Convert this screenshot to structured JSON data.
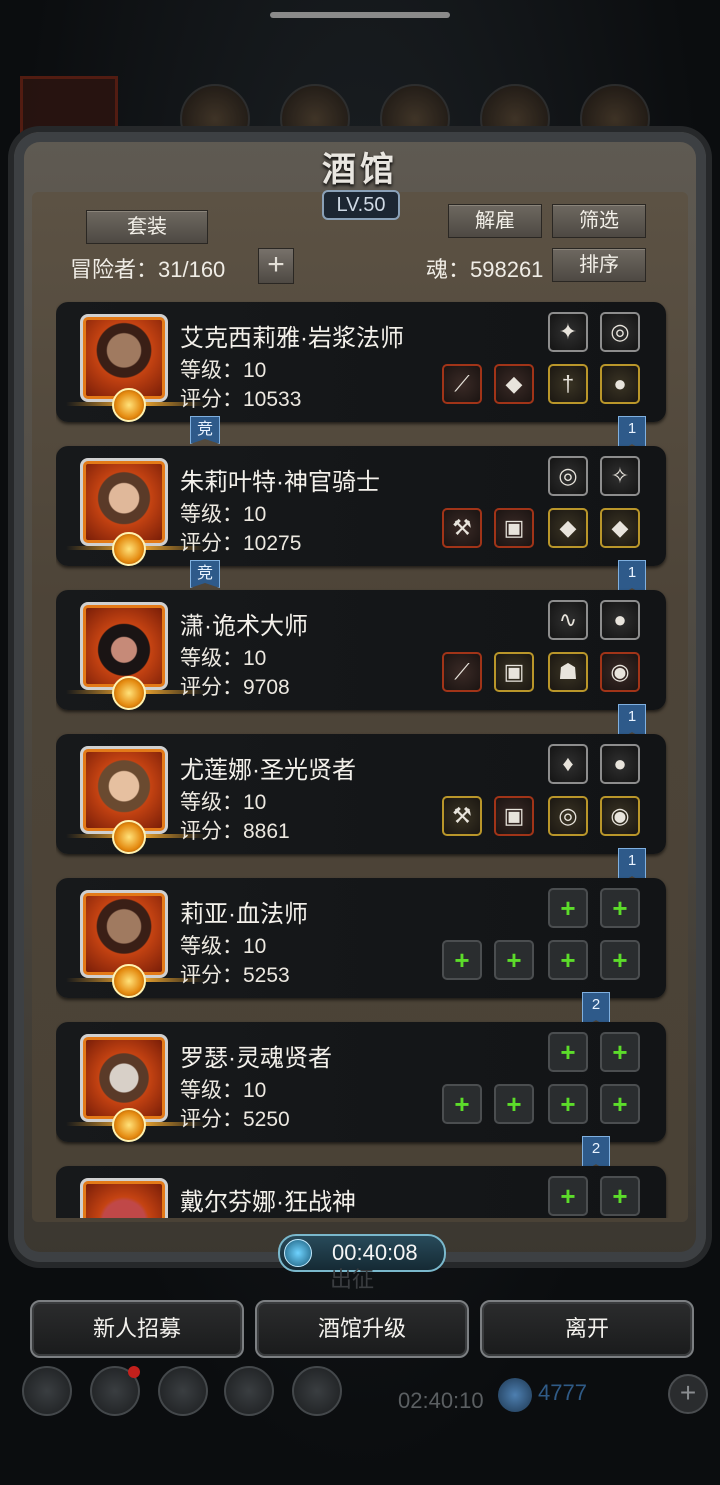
{
  "header": {
    "title": "酒馆",
    "level": "LV.50",
    "set_label": "套装",
    "dismiss_label": "解雇",
    "filter_label": "筛选",
    "sort_label": "排序",
    "adventurers": "冒险者：31/160",
    "soul": "魂：598261"
  },
  "tags": {
    "arena": "竞"
  },
  "heroes": [
    {
      "name": "艾克西莉雅·岩浆法师",
      "level": "等级：10",
      "score": "评分：10533",
      "ribbon": "1"
    },
    {
      "name": "朱莉叶特·神官骑士",
      "level": "等级：10",
      "score": "评分：10275",
      "ribbon": "1"
    },
    {
      "name": "潇·诡术大师",
      "level": "等级：10",
      "score": "评分：9708",
      "ribbon": "1"
    },
    {
      "name": "尤莲娜·圣光贤者",
      "level": "等级：10",
      "score": "评分：8861",
      "ribbon": "1"
    },
    {
      "name": "莉亚·血法师",
      "level": "等级：10",
      "score": "评分：5253",
      "ribbon": "2"
    },
    {
      "name": "罗瑟·灵魂贤者",
      "level": "等级：10",
      "score": "评分：5250",
      "ribbon": "2"
    },
    {
      "name": "戴尔芬娜·狂战神"
    }
  ],
  "timer": {
    "value": "00:40:08",
    "label": "出征"
  },
  "footer": {
    "recruit": "新人招募",
    "upgrade": "酒馆升级",
    "leave": "离开"
  },
  "bottom": {
    "timer": "02:40:10",
    "diamonds": "4777"
  }
}
